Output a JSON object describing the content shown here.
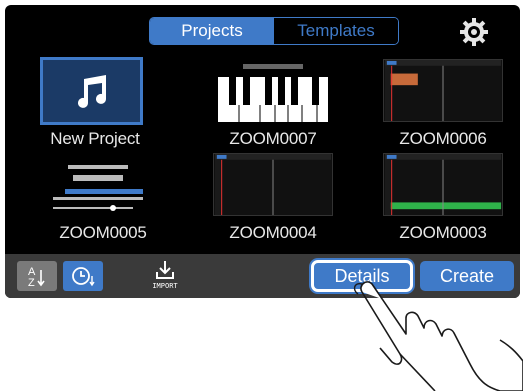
{
  "tabs": {
    "projects": "Projects",
    "templates": "Templates"
  },
  "projects": [
    {
      "label": "New Project"
    },
    {
      "label": "ZOOM0007"
    },
    {
      "label": "ZOOM0006"
    },
    {
      "label": "ZOOM0005"
    },
    {
      "label": "ZOOM0004"
    },
    {
      "label": "ZOOM0003"
    }
  ],
  "bottom": {
    "import_label": "IMPORT",
    "details_label": "Details",
    "create_label": "Create"
  },
  "colors": {
    "accent": "#3f7ac8",
    "background": "#000000",
    "bar": "#3a3a3a"
  },
  "icons": [
    "gear-icon",
    "music-note-icon",
    "sort-az-icon",
    "clock-icon",
    "import-icon",
    "hand-pointer-icon"
  ]
}
